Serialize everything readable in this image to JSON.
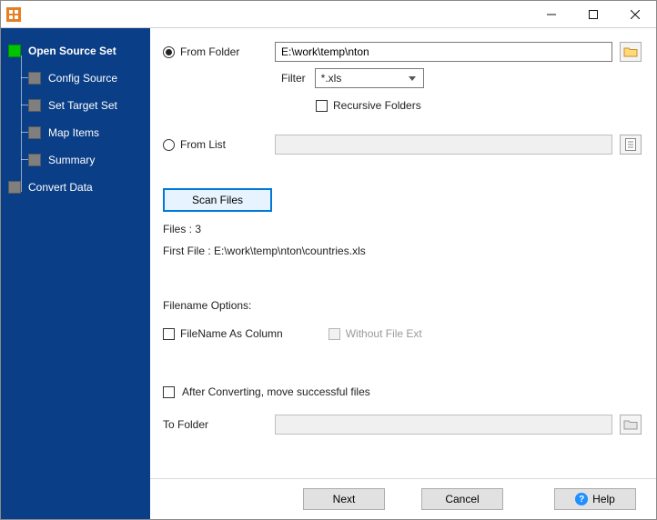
{
  "sidebar": {
    "items": [
      {
        "label": "Open Source Set",
        "active": true
      },
      {
        "label": "Config Source"
      },
      {
        "label": "Set Target Set"
      },
      {
        "label": "Map Items"
      },
      {
        "label": "Summary"
      },
      {
        "label": "Convert Data"
      }
    ]
  },
  "source": {
    "from_folder_label": "From Folder",
    "folder_path": "E:\\work\\temp\\nton",
    "filter_label": "Filter",
    "filter_value": "*.xls",
    "recursive_label": "Recursive Folders",
    "from_list_label": "From List",
    "from_list_value": ""
  },
  "scan": {
    "button_label": "Scan Files",
    "files_label": "Files : 3",
    "first_file_label": "First File : E:\\work\\temp\\nton\\countries.xls"
  },
  "filename_options": {
    "heading": "Filename Options:",
    "filename_as_column_label": "FileName As Column",
    "without_ext_label": "Without File Ext"
  },
  "after": {
    "move_label": "After Converting, move successful files",
    "to_folder_label": "To Folder",
    "to_folder_value": ""
  },
  "footer": {
    "next": "Next",
    "cancel": "Cancel",
    "help": "Help"
  }
}
